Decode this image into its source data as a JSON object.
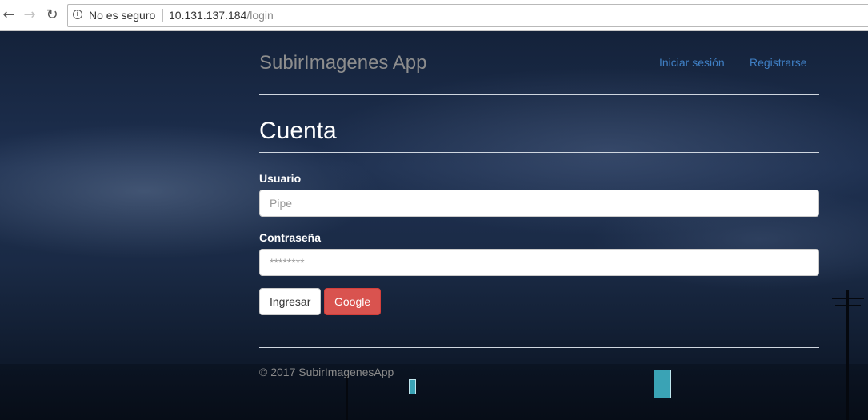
{
  "browser": {
    "back_icon": "arrow-left-icon",
    "forward_icon": "arrow-right-icon",
    "reload_icon": "reload-icon",
    "security_label": "No es seguro",
    "url_host": "10.131.137.184",
    "url_path": "/login"
  },
  "navbar": {
    "brand": "SubirImagenes App",
    "links": [
      "Iniciar sesión",
      "Registrarse"
    ]
  },
  "form": {
    "heading": "Cuenta",
    "username_label": "Usuario",
    "username_placeholder": "Pipe",
    "password_label": "Contraseña",
    "password_placeholder": "********",
    "submit_label": "Ingresar",
    "google_label": "Google"
  },
  "footer": {
    "text": "© 2017 SubirImagenesApp"
  },
  "colors": {
    "link": "#3f7fc4",
    "danger": "#d9534f"
  }
}
